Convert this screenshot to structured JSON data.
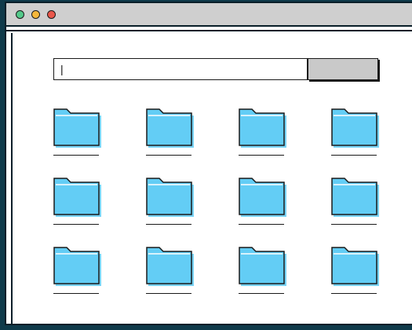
{
  "window": {
    "controls": {
      "close_color": "#e9574b",
      "minimize_color": "#f5b73b",
      "zoom_color": "#53c98a"
    }
  },
  "search": {
    "value": "|",
    "placeholder": "",
    "button_label": ""
  },
  "colors": {
    "folder_fill": "#63cdf5",
    "folder_shadow": "#63cdf5",
    "titlebar": "#cfcfcf",
    "page_background": "#0f3a4a"
  },
  "folders": [
    {
      "label": "",
      "icon": "folder-icon"
    },
    {
      "label": "",
      "icon": "folder-icon"
    },
    {
      "label": "",
      "icon": "folder-icon"
    },
    {
      "label": "",
      "icon": "folder-icon"
    },
    {
      "label": "",
      "icon": "folder-icon"
    },
    {
      "label": "",
      "icon": "folder-icon"
    },
    {
      "label": "",
      "icon": "folder-icon"
    },
    {
      "label": "",
      "icon": "folder-icon"
    },
    {
      "label": "",
      "icon": "folder-icon"
    },
    {
      "label": "",
      "icon": "folder-icon"
    },
    {
      "label": "",
      "icon": "folder-icon"
    },
    {
      "label": "",
      "icon": "folder-icon"
    }
  ]
}
